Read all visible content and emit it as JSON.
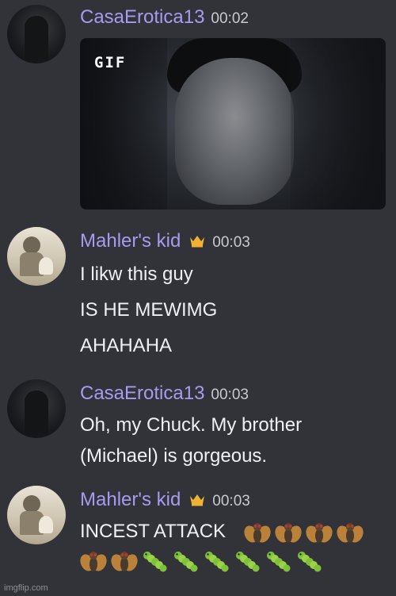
{
  "messages": [
    {
      "author": "CasaErotica13",
      "time": "00:02",
      "attachment": {
        "badge": "GIF"
      },
      "lines": []
    },
    {
      "author": "Mahler's kid",
      "time": "00:03",
      "crown_icon": "crown-icon",
      "lines": [
        "I likw this guy",
        "IS HE MEWIMG",
        "AHAHAHA"
      ]
    },
    {
      "author": "CasaErotica13",
      "time": "00:03",
      "lines": [
        "Oh, my Chuck. My brother",
        "(Michael) is gorgeous."
      ]
    },
    {
      "author": "Mahler's kid",
      "time": "00:03",
      "crown_icon": "crown-icon",
      "lines": [
        "INCEST ATTACK"
      ],
      "emojis_line1": [
        "fly",
        "fly",
        "fly",
        "fly"
      ],
      "emojis_line2": [
        "fly",
        "fly",
        "bug",
        "bug",
        "bug",
        "bug",
        "bug",
        "bug"
      ]
    }
  ],
  "watermark": "imgflip.com",
  "colors": {
    "background": "#313338",
    "author": "#a99af0",
    "crown": "#f0b232"
  }
}
